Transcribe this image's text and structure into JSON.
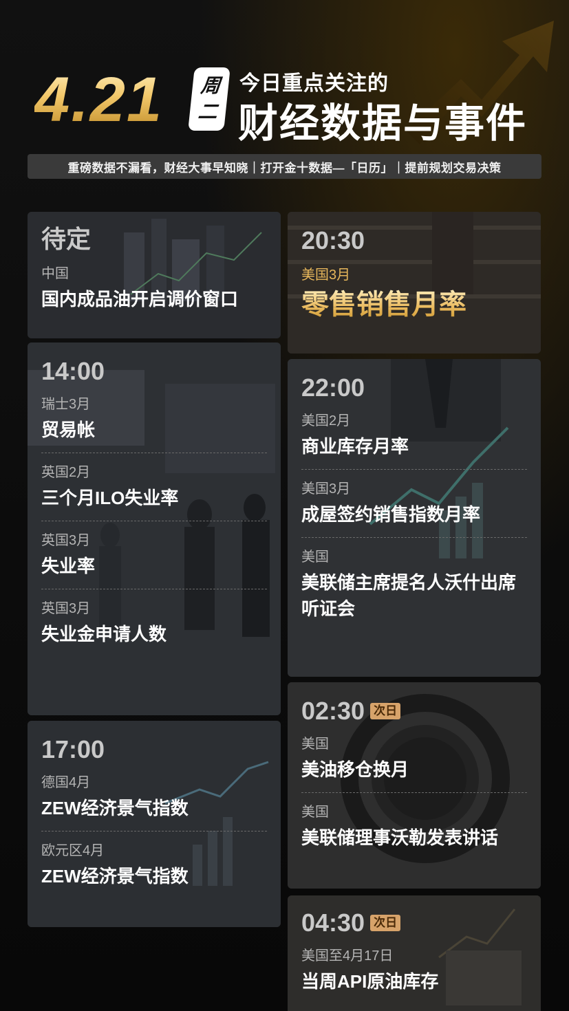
{
  "header": {
    "date": "4.21",
    "weekday": [
      "周",
      "二"
    ],
    "headline_small": "今日重点关注的",
    "headline_big": "财经数据与事件"
  },
  "tagline": "重磅数据不漏看，财经大事早知晓｜打开金十数据—「日历」｜提前规划交易决策",
  "left_column": [
    {
      "time": "待定",
      "items": [
        {
          "region": "中国",
          "event": "国内成品油开启调价窗口"
        }
      ]
    },
    {
      "time": "14:00",
      "items": [
        {
          "region": "瑞士3月",
          "event": "贸易帐"
        },
        {
          "region": "英国2月",
          "event": "三个月ILO失业率"
        },
        {
          "region": "英国3月",
          "event": "失业率"
        },
        {
          "region": "英国3月",
          "event": "失业金申请人数"
        }
      ]
    },
    {
      "time": "17:00",
      "items": [
        {
          "region": "德国4月",
          "event": "ZEW经济景气指数"
        },
        {
          "region": "欧元区4月",
          "event": "ZEW经济景气指数"
        }
      ]
    }
  ],
  "right_column": [
    {
      "time": "20:30",
      "items": [
        {
          "region": "美国3月",
          "event": "零售销售月率"
        }
      ]
    },
    {
      "time": "22:00",
      "items": [
        {
          "region": "美国2月",
          "event": "商业库存月率"
        },
        {
          "region": "美国3月",
          "event": "成屋签约销售指数月率"
        },
        {
          "region": "美国",
          "event": "美联储主席提名人沃什出席听证会"
        }
      ]
    },
    {
      "time": "02:30",
      "badge": "次日",
      "items": [
        {
          "region": "美国",
          "event": "美油移仓换月"
        },
        {
          "region": "美国",
          "event": "美联储理事沃勒发表讲话"
        }
      ]
    },
    {
      "time": "04:30",
      "badge": "次日",
      "items": [
        {
          "region": "美国至4月17日",
          "event": "当周API原油库存"
        }
      ]
    }
  ],
  "colors": {
    "accent_gold": "#e9b85a",
    "badge_bg": "#d7a36a",
    "card_bg": "#2b2b2b"
  }
}
